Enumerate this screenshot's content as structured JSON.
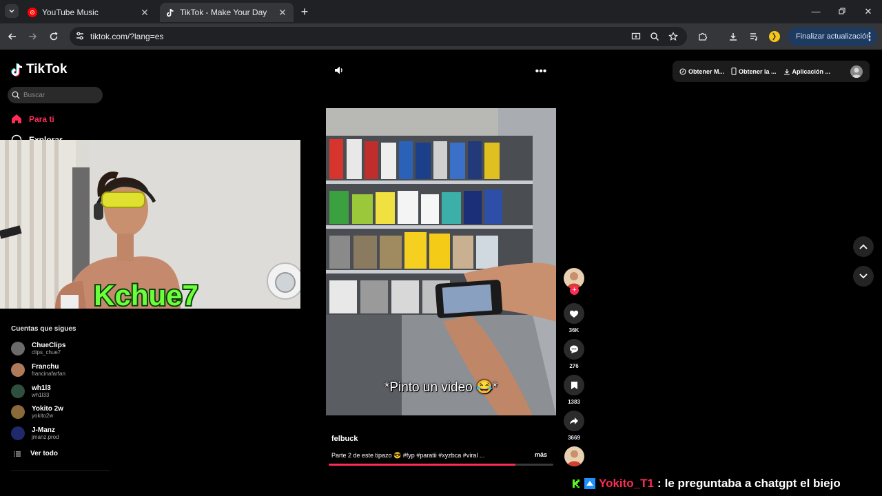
{
  "browser": {
    "tabs": [
      {
        "title": "YouTube Music",
        "active": false
      },
      {
        "title": "TikTok - Make Your Day",
        "active": true
      }
    ],
    "url": "tiktok.com/?lang=es",
    "update_label": "Finalizar actualización"
  },
  "tiktok": {
    "logo": "TikTok",
    "search_placeholder": "Buscar",
    "nav": {
      "for_you": "Para ti",
      "explore": "Explorar"
    },
    "following_title": "Cuentas que sigues",
    "accounts": [
      {
        "name": "ChueClips",
        "handle": "clips_chue7",
        "color": "#6b6b6b"
      },
      {
        "name": "Franchu",
        "handle": "francinafarfan",
        "color": "#b07a5a"
      },
      {
        "name": "wh1l3",
        "handle": "wh1l33",
        "color": "#2f4f3f"
      },
      {
        "name": "Yokito 2w",
        "handle": "yokito2w",
        "color": "#8a6a3a"
      },
      {
        "name": "J-Manz",
        "handle": "jmanz.prod",
        "color": "#1e2a6b"
      }
    ],
    "see_all": "Ver todo",
    "topbar": {
      "item1": "Obtener M...",
      "item2": "Obtener la ...",
      "item3": "Aplicación ..."
    },
    "video": {
      "caption": "*Pinto un video 😂*",
      "author": "felbuck",
      "description": "Parte 2 de este tipazo 😎 #fyp #paratii #xyzbca #viral ...",
      "more": "más",
      "progress": 0.83
    },
    "actions": {
      "likes": "36K",
      "comments": "276",
      "saves": "1383",
      "shares": "3669"
    }
  },
  "overlay": {
    "streamer_name": "Kchue7",
    "chat_user": "Yokito_T1",
    "chat_sep": ":",
    "chat_message": "le preguntaba a chatgpt el biejo"
  },
  "colors": {
    "accent": "#fe2c55",
    "browser_bg": "#202124",
    "toolbar_bg": "#35363a",
    "update_bg": "#1f3a5f"
  }
}
